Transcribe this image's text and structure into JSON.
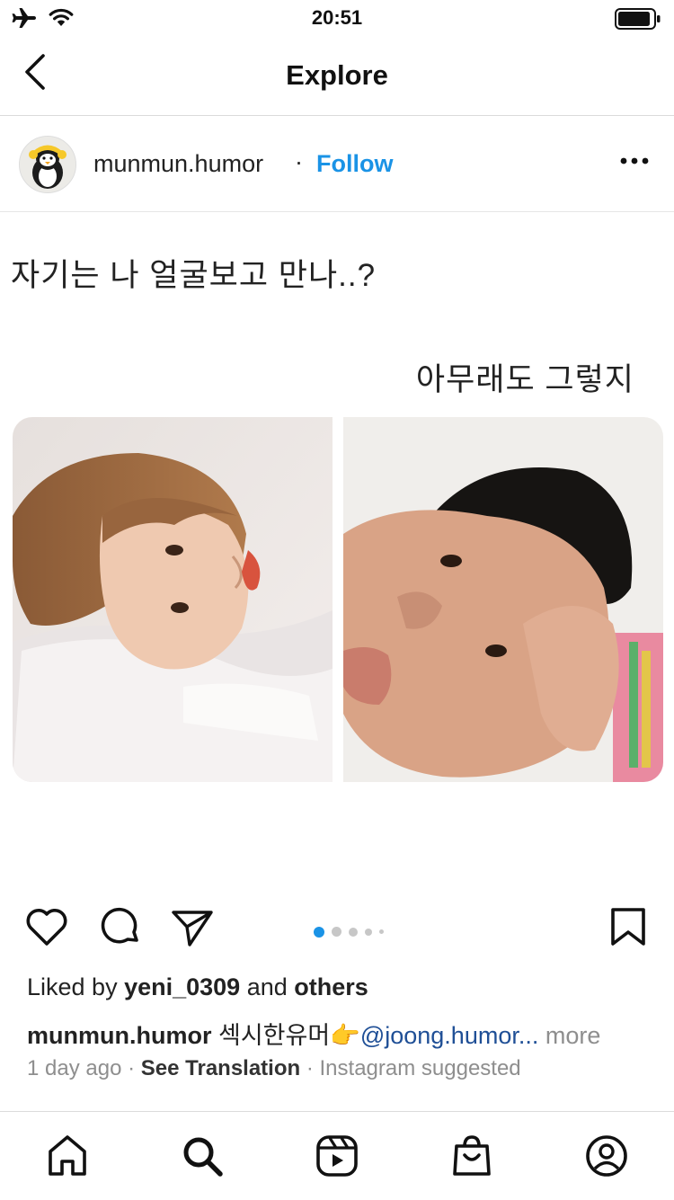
{
  "status_bar": {
    "time": "20:51"
  },
  "header": {
    "title": "Explore"
  },
  "post": {
    "username": "munmun.humor",
    "separator": "·",
    "follow_label": "Follow",
    "image_text_top": "자기는 나 얼굴보고 만나..?",
    "image_text_reply": "아무래도 그렇지",
    "carousel": {
      "count": 5,
      "active_index": 0
    },
    "liked_prefix": "Liked by",
    "liked_user": "yeni_0309",
    "liked_and": "and",
    "liked_others": "others",
    "caption_user": "munmun.humor",
    "caption_text": "섹시한유머👉",
    "caption_mention": "@joong.humor...",
    "caption_more": "more",
    "time_ago": "1 day ago",
    "meta_sep1": "·",
    "see_translation": "See Translation",
    "meta_sep2": "·",
    "suggested": "Instagram suggested"
  },
  "icons": {
    "back": "chevron-left-icon",
    "more": "more-horizontal-icon",
    "like": "heart-icon",
    "comment": "comment-icon",
    "share": "send-icon",
    "save": "bookmark-icon",
    "tabs": [
      "home-icon",
      "search-icon",
      "reels-icon",
      "shop-icon",
      "profile-icon"
    ]
  },
  "colors": {
    "accent": "#1a93e6",
    "mention": "#1f4f96",
    "muted": "#8e8e8e",
    "carousel_active": "#1a93e6"
  }
}
